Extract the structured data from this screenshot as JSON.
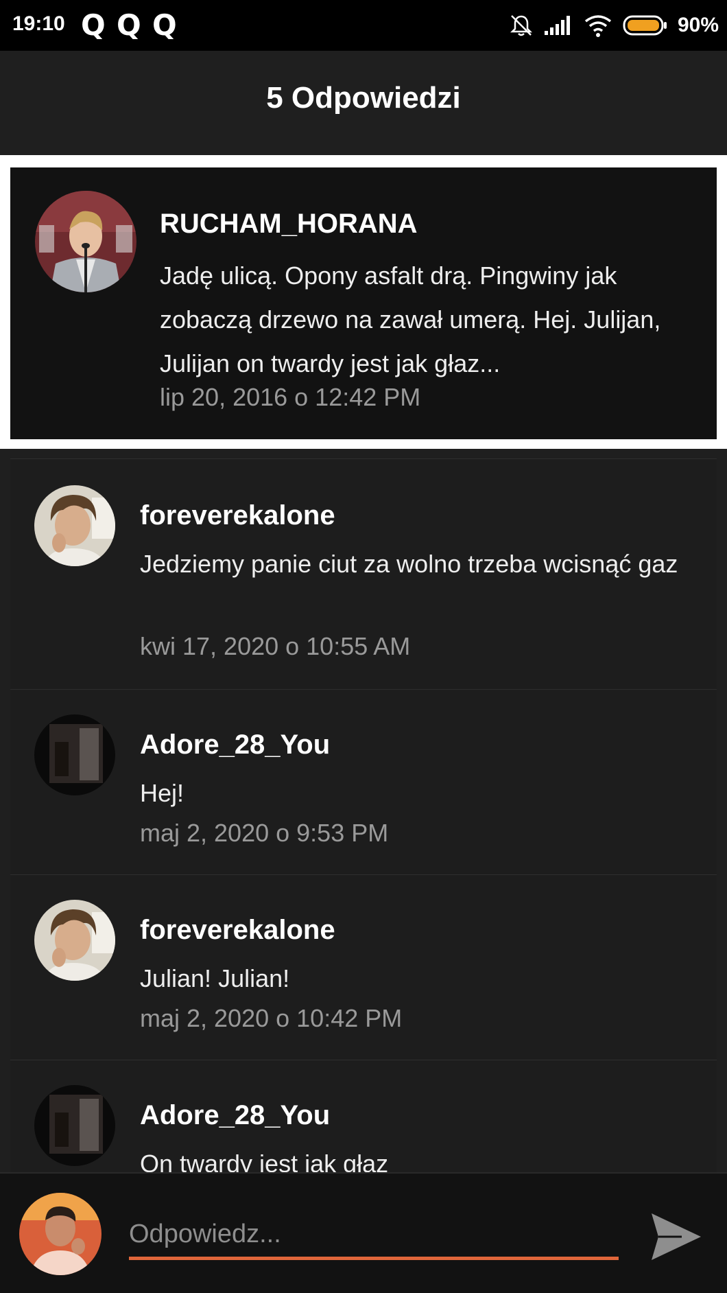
{
  "status_bar": {
    "time": "19:10",
    "notification_icons": [
      "Q",
      "Q",
      "Q"
    ],
    "icons": [
      "bell-muted-icon",
      "signal-icon",
      "wifi-icon",
      "battery-icon"
    ],
    "battery_percent": "90%",
    "battery_color": "#f0a020"
  },
  "app_bar": {
    "title": "5 Odpowiedzi"
  },
  "parent_comment": {
    "username": "RUCHAM_HORANA",
    "text": "Jadę ulicą. Opony asfalt drą. Pingwiny jak zobaczą drzewo na zawał umerą. Hej. Julijan, Julijan on twardy jest jak głaz...",
    "date": "lip 20, 2016 o 12:42 PM"
  },
  "replies": [
    {
      "username": "foreverekalone",
      "text": "Jedziemy panie ciut za wolno trzeba wcisnąć gaz",
      "date": "kwi 17, 2020 o 10:55 AM"
    },
    {
      "username": "Adore_28_You",
      "text": "Hej!",
      "date": "maj 2, 2020 o 9:53 PM"
    },
    {
      "username": "foreverekalone",
      "text": "Julian! Julian!",
      "date": "maj 2, 2020 o 10:42 PM"
    },
    {
      "username": "Adore_28_You",
      "text": "On twardy jest jak głaz",
      "date": ""
    }
  ],
  "composer": {
    "placeholder": "Odpowiedz...",
    "accent": "#e0663a"
  }
}
